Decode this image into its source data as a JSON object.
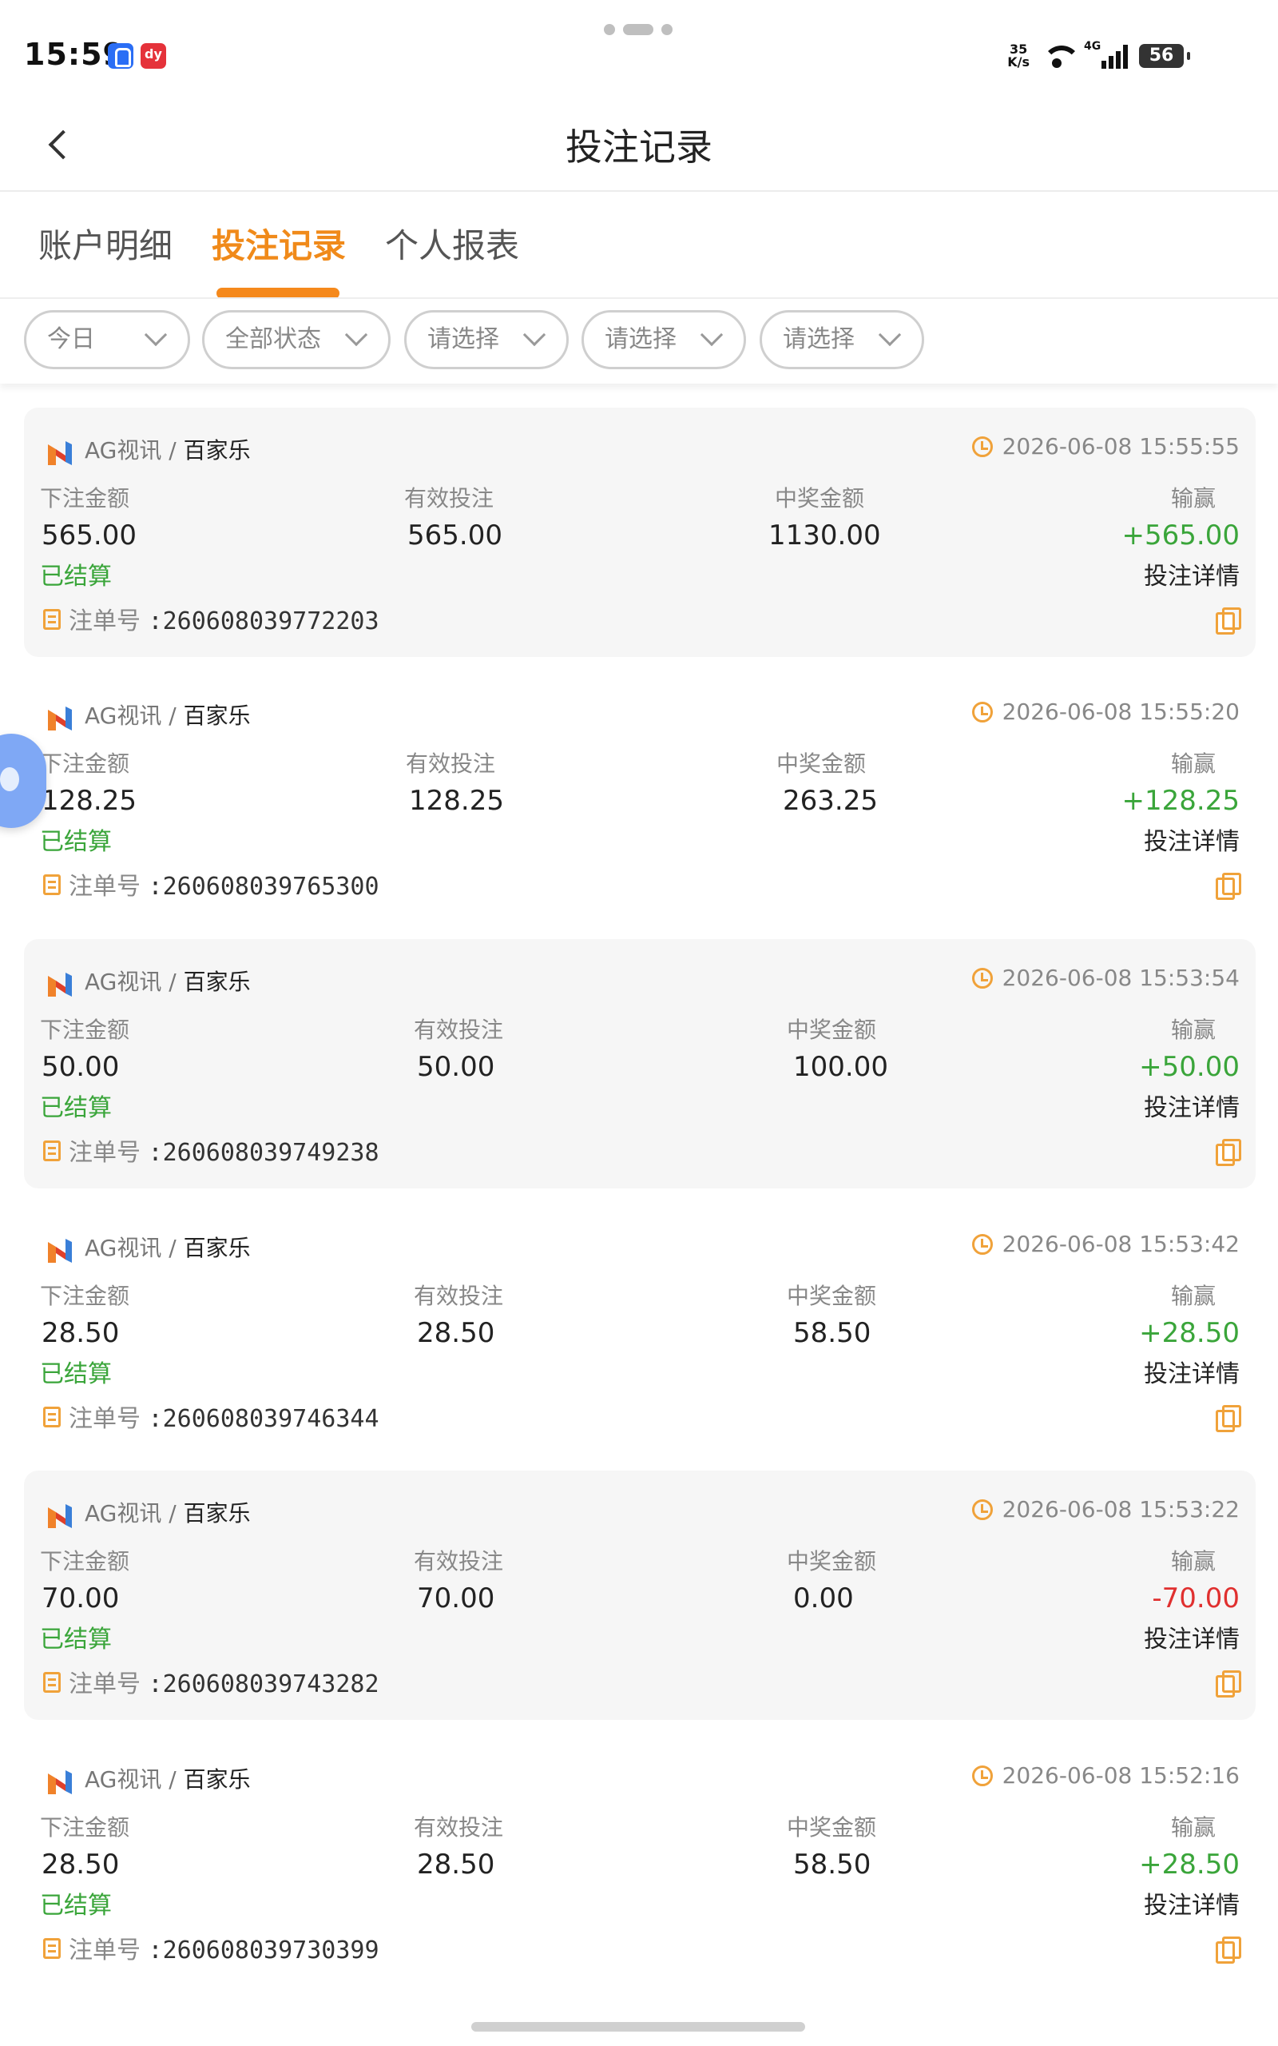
{
  "status_bar": {
    "time": "15:59",
    "net_speed_value": "35",
    "net_speed_unit": "K/s",
    "network": "4G",
    "battery": "56"
  },
  "nav": {
    "title": "投注记录"
  },
  "tabs": [
    {
      "label": "账户明细",
      "active": false
    },
    {
      "label": "投注记录",
      "active": true
    },
    {
      "label": "个人报表",
      "active": false
    }
  ],
  "filters": [
    {
      "label": "今日"
    },
    {
      "label": "全部状态"
    },
    {
      "label": "请选择"
    },
    {
      "label": "请选择"
    },
    {
      "label": "请选择"
    }
  ],
  "column_labels": {
    "bet_amount": "下注金额",
    "valid_bet": "有效投注",
    "prize_amount": "中奖金额",
    "win_loss": "输赢",
    "order_label": "注单号",
    "detail": "投注详情"
  },
  "colors": {
    "accent": "#f5891c",
    "win": "#3aa53a",
    "lose": "#e0302f",
    "chip_border": "#cfcfcf"
  },
  "records": [
    {
      "provider": "AG视讯",
      "game": "百家乐",
      "time": "2026-06-08 15:55:55",
      "bet": "565.00",
      "valid": "565.00",
      "prize": "1130.00",
      "result": "+565.00",
      "result_type": "win",
      "status": "已结算",
      "order": ":260608039772203"
    },
    {
      "provider": "AG视讯",
      "game": "百家乐",
      "time": "2026-06-08 15:55:20",
      "bet": "128.25",
      "valid": "128.25",
      "prize": "263.25",
      "result": "+128.25",
      "result_type": "win",
      "status": "已结算",
      "order": ":260608039765300"
    },
    {
      "provider": "AG视讯",
      "game": "百家乐",
      "time": "2026-06-08 15:53:54",
      "bet": "50.00",
      "valid": "50.00",
      "prize": "100.00",
      "result": "+50.00",
      "result_type": "win",
      "status": "已结算",
      "order": ":260608039749238"
    },
    {
      "provider": "AG视讯",
      "game": "百家乐",
      "time": "2026-06-08 15:53:42",
      "bet": "28.50",
      "valid": "28.50",
      "prize": "58.50",
      "result": "+28.50",
      "result_type": "win",
      "status": "已结算",
      "order": ":260608039746344"
    },
    {
      "provider": "AG视讯",
      "game": "百家乐",
      "time": "2026-06-08 15:53:22",
      "bet": "70.00",
      "valid": "70.00",
      "prize": "0.00",
      "result": "-70.00",
      "result_type": "lose",
      "status": "已结算",
      "order": ":260608039743282"
    },
    {
      "provider": "AG视讯",
      "game": "百家乐",
      "time": "2026-06-08 15:52:16",
      "bet": "28.50",
      "valid": "28.50",
      "prize": "58.50",
      "result": "+28.50",
      "result_type": "win",
      "status": "已结算",
      "order": ":260608039730399"
    }
  ]
}
